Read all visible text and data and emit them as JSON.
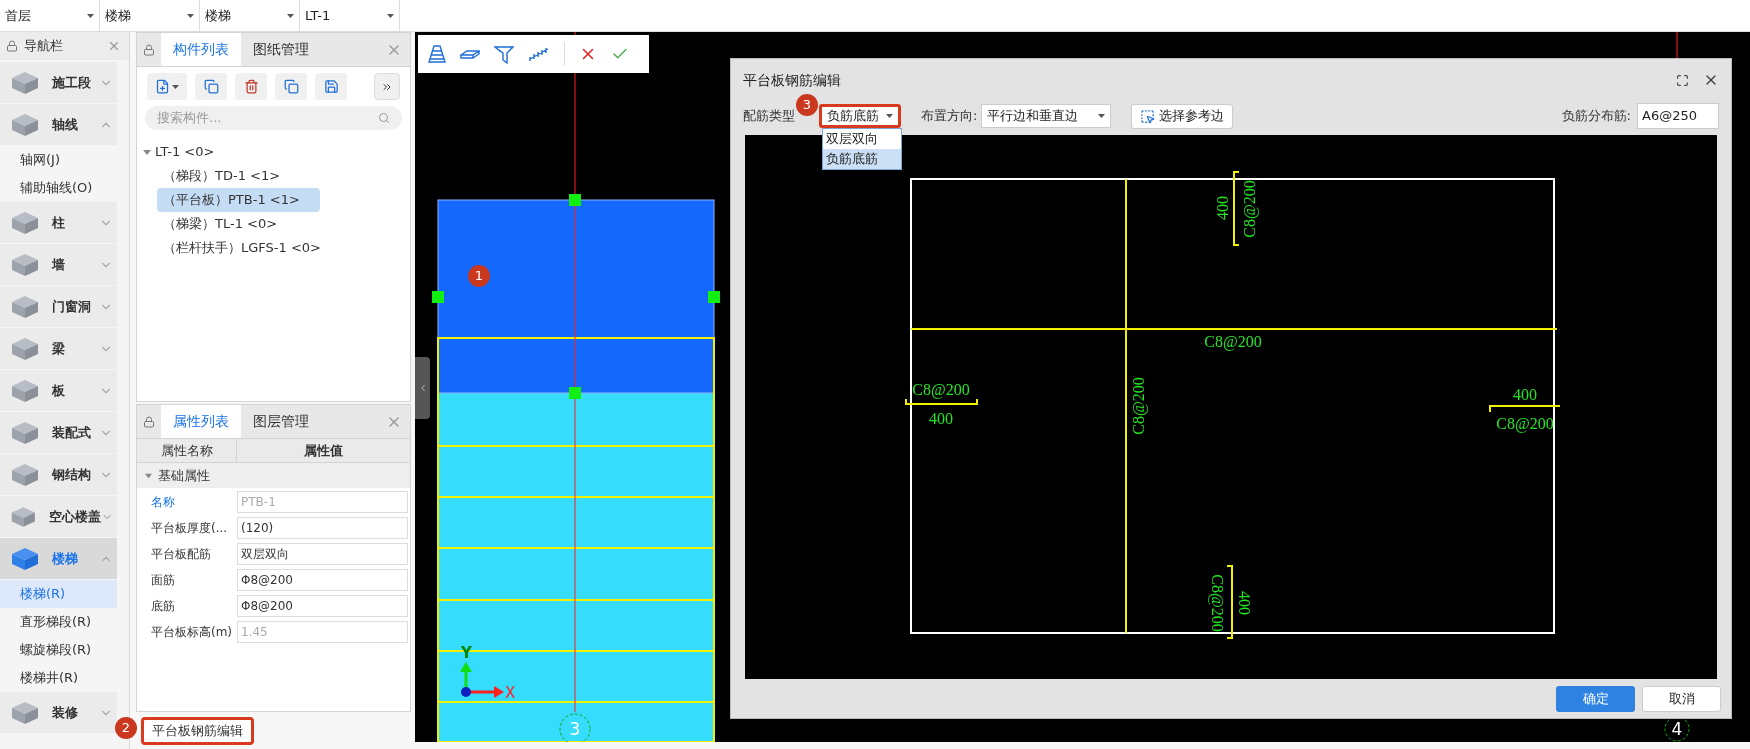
{
  "top_selectors": [
    {
      "value": "首层"
    },
    {
      "value": "楼梯"
    },
    {
      "value": "楼梯"
    },
    {
      "value": "LT-1"
    }
  ],
  "nav": {
    "title": "导航栏",
    "items": [
      {
        "label": "施工段",
        "expanded": false,
        "selected": false
      },
      {
        "label": "轴线",
        "expanded": true,
        "selected": false,
        "children": [
          {
            "label": "轴网(J)",
            "selected": false
          },
          {
            "label": "辅助轴线(O)",
            "selected": false
          }
        ]
      },
      {
        "label": "柱",
        "expanded": false,
        "selected": false
      },
      {
        "label": "墙",
        "expanded": false,
        "selected": false
      },
      {
        "label": "门窗洞",
        "expanded": false,
        "selected": false
      },
      {
        "label": "梁",
        "expanded": false,
        "selected": false
      },
      {
        "label": "板",
        "expanded": false,
        "selected": false
      },
      {
        "label": "装配式",
        "expanded": false,
        "selected": false
      },
      {
        "label": "钢结构",
        "expanded": false,
        "selected": false
      },
      {
        "label": "空心楼盖",
        "expanded": false,
        "selected": false
      },
      {
        "label": "楼梯",
        "expanded": true,
        "selected": true,
        "children": [
          {
            "label": "楼梯(R)",
            "selected": true
          },
          {
            "label": "直形梯段(R)",
            "selected": false
          },
          {
            "label": "螺旋梯段(R)",
            "selected": false
          },
          {
            "label": "楼梯井(R)",
            "selected": false
          }
        ]
      },
      {
        "label": "装修",
        "expanded": false,
        "selected": false
      }
    ]
  },
  "component_panel": {
    "tabs": [
      {
        "label": "构件列表",
        "selected": true
      },
      {
        "label": "图纸管理",
        "selected": false
      }
    ],
    "search": {
      "placeholder": "搜索构件..."
    },
    "tree": [
      {
        "label": "LT-1 <0>",
        "selected": false,
        "expanded": true,
        "children": [
          {
            "label": "（梯段）TD-1 <1>",
            "selected": false
          },
          {
            "label": "（平台板）PTB-1 <1>",
            "selected": true
          },
          {
            "label": "（梯梁）TL-1 <0>",
            "selected": false
          },
          {
            "label": "（栏杆扶手）LGFS-1 <0>",
            "selected": false
          }
        ]
      }
    ]
  },
  "property_panel": {
    "tabs": [
      {
        "label": "属性列表",
        "selected": true
      },
      {
        "label": "图层管理",
        "selected": false
      }
    ],
    "columns": [
      "属性名称",
      "属性值"
    ],
    "group": {
      "label": "基础属性",
      "expanded": true
    },
    "rows": [
      {
        "name": "名称",
        "value": "PTB-1",
        "highlighted": true,
        "disabled": true
      },
      {
        "name": "平台板厚度(...",
        "value": "(120)",
        "highlighted": false,
        "disabled": false
      },
      {
        "name": "平台板配筋",
        "value": "双层双向",
        "highlighted": false,
        "disabled": false
      },
      {
        "name": "面筋",
        "value": "Φ8@200",
        "highlighted": false,
        "disabled": false
      },
      {
        "name": "底筋",
        "value": "Φ8@200",
        "highlighted": false,
        "disabled": false
      },
      {
        "name": "平台板标高(m)",
        "value": "1.45",
        "highlighted": false,
        "disabled": true
      }
    ]
  },
  "edit_button": {
    "label": "平台板钢筋编辑",
    "highlighted": true,
    "marker": "2"
  },
  "canvas": {
    "marker": "1",
    "axis_labels": [
      "3",
      "4"
    ],
    "coord_labels": [
      "X",
      "Y"
    ]
  },
  "dialog": {
    "title": "平台板钢筋编辑",
    "type_label": "配筋类型",
    "type_select": {
      "value": "负筋底筋",
      "highlighted": true,
      "marker": "3",
      "open": true,
      "options": [
        {
          "label": "双层双向",
          "selected": false
        },
        {
          "label": "负筋底筋",
          "selected": true
        }
      ]
    },
    "direction_label": "布置方向:",
    "direction_select": {
      "value": "平行边和垂直边"
    },
    "pick_button": {
      "label": "选择参考边"
    },
    "distribution_label": "负筋分布筋:",
    "distribution_value": "A6@250",
    "rebar_labels": [
      "400",
      "C8@200",
      "C8@200",
      "C8@200",
      "400",
      "C8@200",
      "400",
      "C8@200",
      "C8@200",
      "400"
    ],
    "buttons": [
      {
        "label": "确定",
        "kind": "primary"
      },
      {
        "label": "取消",
        "kind": "secondary"
      }
    ]
  }
}
